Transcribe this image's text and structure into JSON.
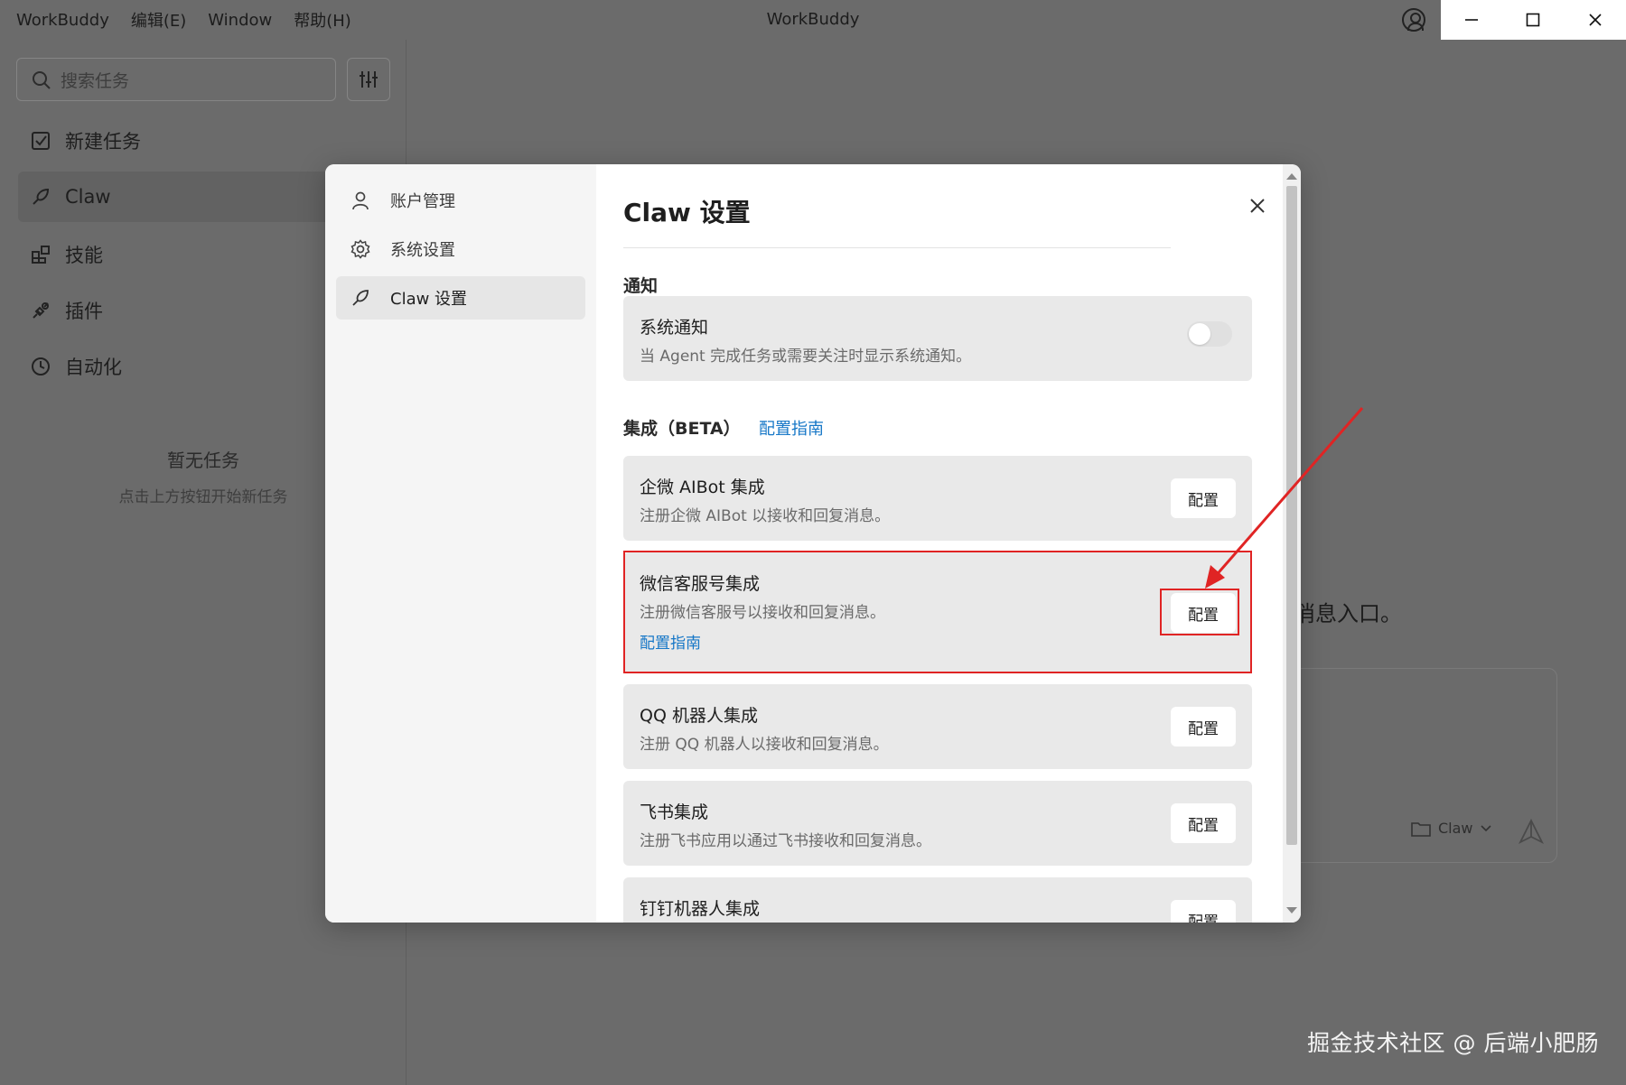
{
  "menu": {
    "app": "WorkBuddy",
    "edit": "编辑(E)",
    "window": "Window",
    "help": "帮助(H)"
  },
  "window": {
    "title": "WorkBuddy"
  },
  "sidebar": {
    "search_placeholder": "搜索任务",
    "items": [
      {
        "label": "新建任务",
        "icon": "new-task-icon"
      },
      {
        "label": "Claw",
        "icon": "claw-icon"
      },
      {
        "label": "技能",
        "icon": "skills-icon"
      },
      {
        "label": "插件",
        "icon": "plugin-icon"
      },
      {
        "label": "自动化",
        "icon": "clock-icon"
      }
    ],
    "empty_title": "暂无任务",
    "empty_subtitle": "点击上方按钮开始新任务"
  },
  "background": {
    "message_fragment": "消息入口。",
    "folder_label": "Claw"
  },
  "dialog": {
    "nav": [
      {
        "label": "账户管理",
        "icon": "user-icon"
      },
      {
        "label": "系统设置",
        "icon": "settings-icon"
      },
      {
        "label": "Claw 设置",
        "icon": "claw-icon"
      }
    ],
    "title": "Claw 设置",
    "notification_section": "通知",
    "notification_card": {
      "title": "系统通知",
      "description": "当 Agent 完成任务或需要关注时显示系统通知。"
    },
    "integration_section": "集成（BETA）",
    "integration_guide_link": "配置指南",
    "integrations": [
      {
        "title": "企微 AIBot 集成",
        "description": "注册企微 AIBot 以接收和回复消息。",
        "button": "配置"
      },
      {
        "title": "微信客服号集成",
        "description": "注册微信客服号以接收和回复消息。",
        "link": "配置指南",
        "button": "配置"
      },
      {
        "title": "QQ 机器人集成",
        "description": "注册 QQ 机器人以接收和回复消息。",
        "button": "配置"
      },
      {
        "title": "飞书集成",
        "description": "注册飞书应用以通过飞书接收和回复消息。",
        "button": "配置"
      },
      {
        "title": "钉钉机器人集成",
        "description": "",
        "button": "配置"
      }
    ]
  },
  "watermark": "掘金技术社区 @ 后端小肥肠",
  "colors": {
    "accent_link": "#1677c7",
    "highlight": "#e02424"
  }
}
